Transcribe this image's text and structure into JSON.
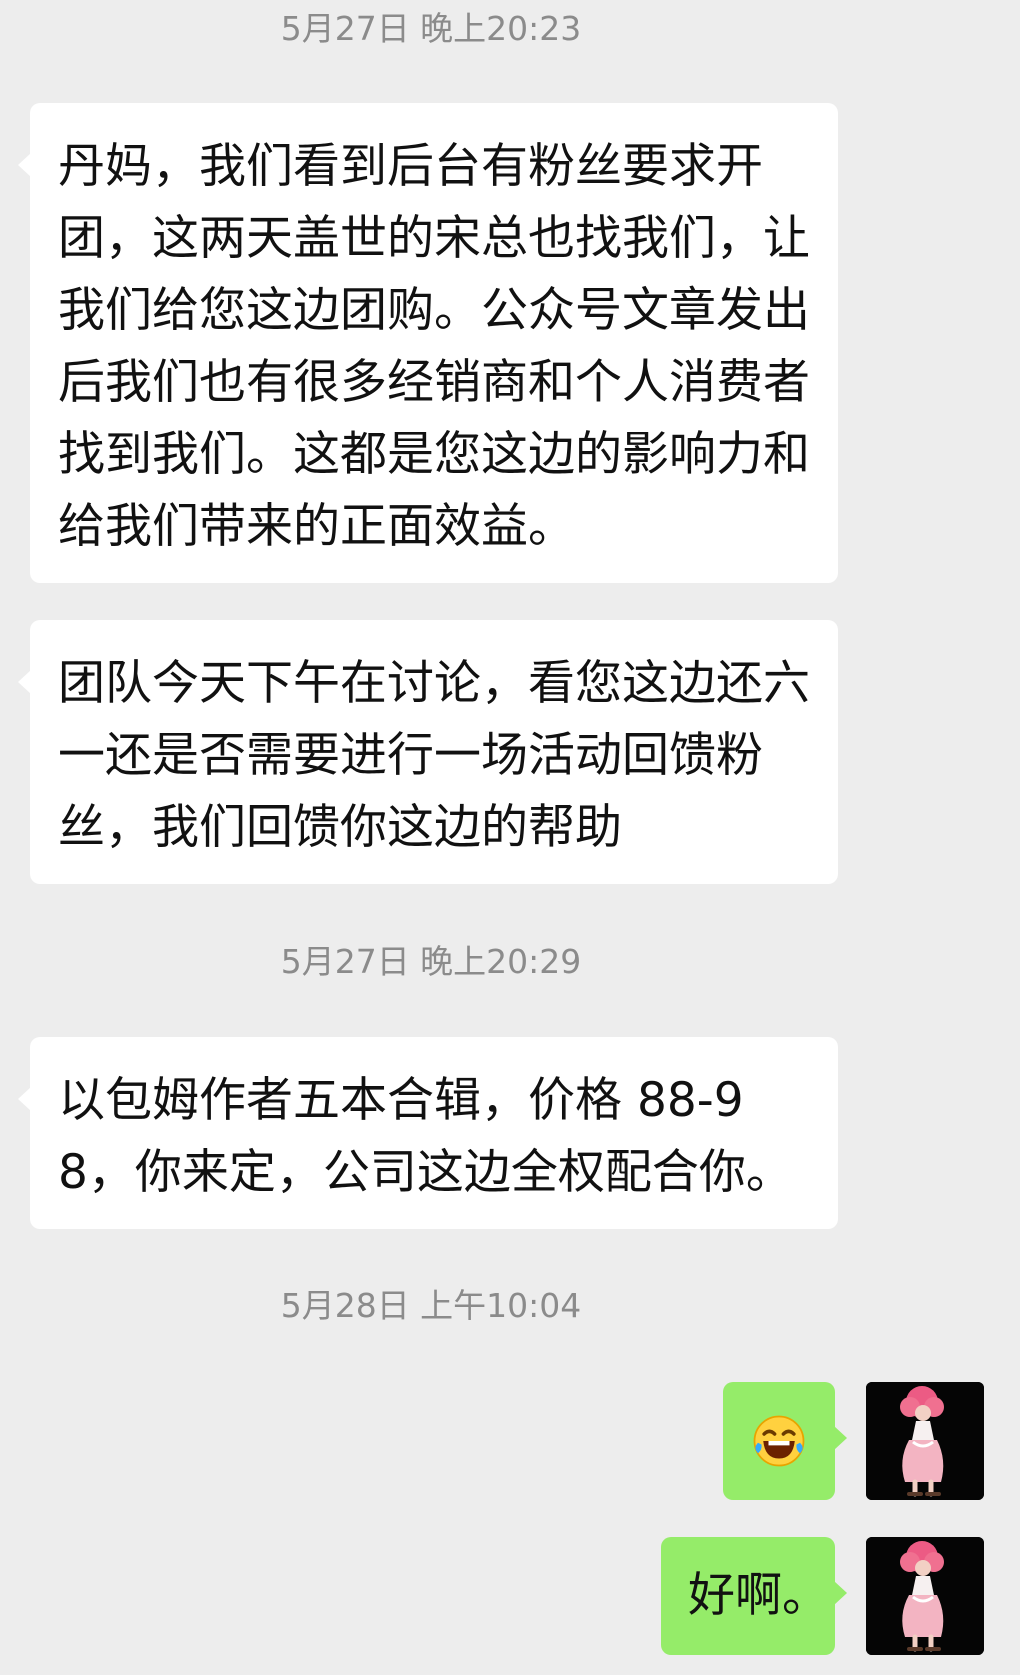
{
  "conversation": {
    "timestamps": [
      "5月27日 晚上20:23",
      "5月27日 晚上20:29",
      "5月28日 上午10:04"
    ],
    "incoming_messages": [
      "丹妈，我们看到后台有粉丝要求开团，这两天盖世的宋总也找我们，让我们给您这边团购。公众号文章发出后我们也有很多经销商和个人消费者找到我们。这都是您这边的影响力和给我们带来的正面效益。",
      "团队今天下午在讨论，看您这边还六一还是否需要进行一场活动回馈粉丝，我们回馈你这边的帮助",
      "以包姆作者五本合辑，价格 88-98，你来定，公司这边全权配合你。"
    ],
    "outgoing_messages": [
      {
        "type": "emoji",
        "emoji_name": "laughing-with-tears-emoji",
        "text": ""
      },
      {
        "type": "text",
        "text": "好啊。"
      }
    ]
  },
  "colors": {
    "background": "#ededed",
    "incoming_bubble": "#ffffff",
    "outgoing_bubble": "#95ec69",
    "timestamp_text": "#8b8b8b",
    "avatar_background": "#050505"
  },
  "icons": {
    "avatar": "pink-haired-character-avatar",
    "emoji": "laughing-with-tears-emoji"
  }
}
